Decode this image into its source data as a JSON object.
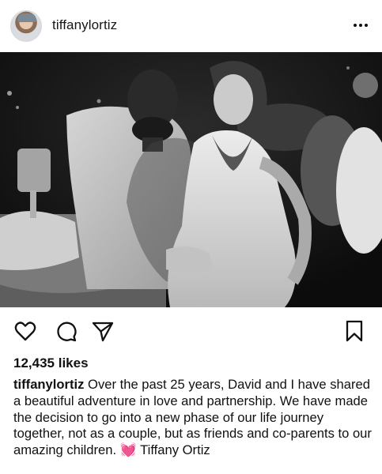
{
  "post": {
    "username": "tiffanylortiz",
    "likes": "12,435 likes",
    "caption_username": "tiffanylortiz",
    "caption_text": " Over the past 25 years, David and I have shared a beautiful adventure in love and partnership. We have made the decision to go into a new phase of our life journey together, not as a couple, but as friends and co-parents to our amazing children. ",
    "caption_emoji": "💓",
    "caption_signature": " Tiffany Ortiz"
  },
  "icons": {
    "more": "more-horizontal-icon",
    "like": "heart-outline-icon",
    "comment": "comment-bubble-icon",
    "share": "paper-plane-icon",
    "save": "bookmark-icon"
  },
  "colors": {
    "text": "#111111",
    "background": "#ffffff",
    "heart_emoji": "#e9559b"
  }
}
